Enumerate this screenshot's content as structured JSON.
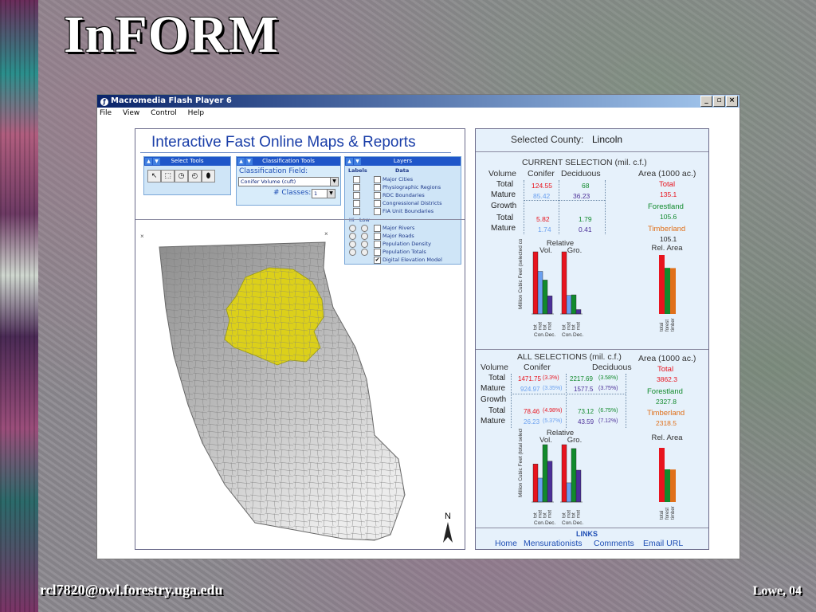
{
  "slide": {
    "title": "InFORM",
    "footer_left": "rcl7820@owl.forestry.uga.edu",
    "footer_right": "Lowe, 04"
  },
  "window": {
    "title": "Macromedia Flash Player 6",
    "menu": [
      "File",
      "View",
      "Control",
      "Help"
    ],
    "buttons": [
      "_",
      "▫",
      "×"
    ]
  },
  "app": {
    "title": "Interactive Fast Online Maps & Reports",
    "select_tools": {
      "label": "Select Tools",
      "buttons": [
        "↖",
        "⬚",
        "◷",
        "◴",
        "⬮"
      ]
    },
    "classification": {
      "label": "Classification Tools",
      "field_label": "Classification Field:",
      "field_value": "Conifer Volume (cuft)",
      "classes_label": "# Classes:",
      "classes_value": "1"
    },
    "layers": {
      "label": "Layers",
      "col_labels": "Labels",
      "col_data": "Data",
      "col_hi": "Hi",
      "col_low": "Low",
      "items_top": [
        "Major Cities",
        "Physiographic Regions",
        "RDC Boundaries",
        "Congressional Districts",
        "FIA Unit Boundaries"
      ],
      "items_bottom": [
        "Major Rivers",
        "Major Roads",
        "Population Density",
        "Population Totals",
        "Digital Elevation Model"
      ],
      "checked_mark": "✔"
    },
    "map": {
      "north_label": "N"
    }
  },
  "report": {
    "county_label": "Selected County:",
    "county": "Lincoln",
    "current": {
      "header": "CURRENT SELECTION (mil. c.f.)",
      "volume": "Volume",
      "conifer": "Conifer",
      "deciduous": "Deciduous",
      "total": "Total",
      "mature": "Mature",
      "growth": "Growth",
      "vol_total_con": "124.55",
      "vol_total_dec": "68",
      "vol_mature_con": "85.42",
      "vol_mature_dec": "36.23",
      "gr_total_con": "5.82",
      "gr_total_dec": "1.79",
      "gr_mature_con": "1.74",
      "gr_mature_dec": "0.41",
      "area_header": "Area (1000 ac.)",
      "area_total_label": "Total",
      "area_total": "135.1",
      "forestland_label": "Forestland",
      "forestland": "105.6",
      "timberland_label": "Timberland",
      "timberland": "105.1"
    },
    "current_charts": {
      "relative": "Relative",
      "vol": "Vol.",
      "gro": "Gro.",
      "ylabel": "Million Cubic Feet (selected county)",
      "bar_labels": [
        "tot",
        "mat",
        "tot",
        "mat"
      ],
      "group_labels": [
        "Con.",
        "Dec."
      ],
      "rel_area": "Rel. Area",
      "area_labels": [
        "total",
        "forest",
        "timber"
      ]
    },
    "all": {
      "header": "ALL SELECTIONS (mil. c.f.)",
      "volume": "Volume",
      "conifer": "Conifer",
      "deciduous": "Deciduous",
      "total": "Total",
      "mature": "Mature",
      "growth": "Growth",
      "vol_total_con": "1471.75",
      "vol_total_con_pct": "(3.3%)",
      "vol_total_dec": "2217.69",
      "vol_total_dec_pct": "(3.58%)",
      "vol_mature_con": "924.97",
      "vol_mature_con_pct": "(3.35%)",
      "vol_mature_dec": "1577.5",
      "vol_mature_dec_pct": "(3.75%)",
      "gr_total_con": "78.46",
      "gr_total_con_pct": "(4.98%)",
      "gr_total_dec": "73.12",
      "gr_total_dec_pct": "(6.75%)",
      "gr_mature_con": "26.23",
      "gr_mature_con_pct": "(5.37%)",
      "gr_mature_dec": "43.59",
      "gr_mature_dec_pct": "(7.12%)",
      "area_header": "Area (1000 ac.)",
      "area_total_label": "Total",
      "area_total": "3862.3",
      "forestland_label": "Forestland",
      "forestland": "2327.8",
      "timberland_label": "Timberland",
      "timberland": "2318.5"
    },
    "all_charts": {
      "relative": "Relative",
      "vol": "Vol.",
      "gro": "Gro.",
      "ylabel": "Million Cubic Feet (total selected)",
      "bar_labels": [
        "tot",
        "mat",
        "tot",
        "mat"
      ],
      "group_labels": [
        "Con.",
        "Dec."
      ],
      "rel_area": "Rel. Area",
      "area_labels": [
        "total",
        "forest",
        "timber"
      ]
    },
    "links": {
      "header": "LINKS",
      "items": [
        "Home",
        "Mensurationists",
        "Comments",
        "Email URL"
      ]
    }
  },
  "colors": {
    "red": "#e8141e",
    "blue": "#6aa0f0",
    "green": "#118a2c",
    "purple": "#4b2f98",
    "orange": "#e0701a",
    "selected_county": "#dcd01a"
  }
}
